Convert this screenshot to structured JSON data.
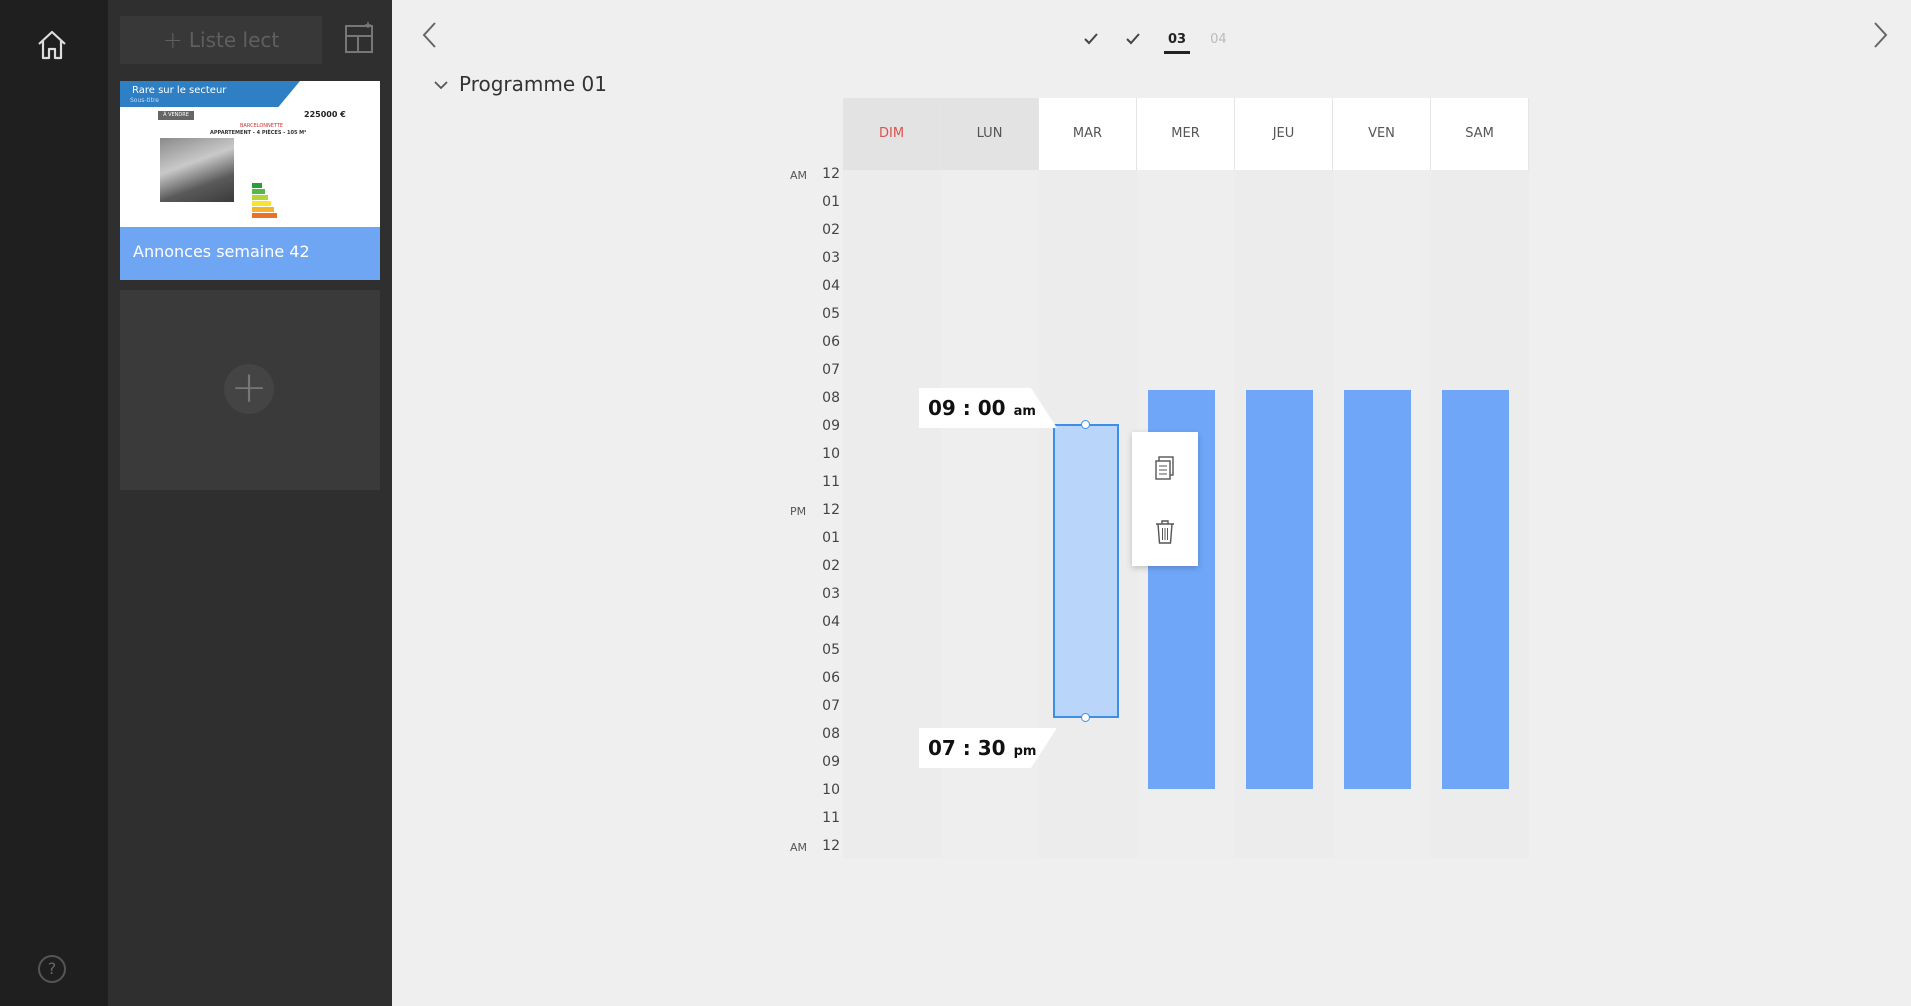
{
  "sidebar": {
    "add_list_label": "Liste lect",
    "add_list_plus": "+",
    "card": {
      "label": "Annonces semaine 42",
      "thumb": {
        "banner_title": "Rare sur le secteur",
        "banner_sub": "Sous-titre",
        "tag": "À VENDRE",
        "price": "225000 €",
        "subtitle": "BARCELONNETTE",
        "subtitle2": "APPARTEMENT - 4 PIÈCES - 105 M²"
      }
    },
    "new_card_plus": "+"
  },
  "rail": {
    "help_label": "?"
  },
  "stepper": {
    "current": "03",
    "next": "04"
  },
  "program": {
    "title": "Programme 01"
  },
  "days": [
    {
      "label": "DIM",
      "state": "disabled"
    },
    {
      "label": "LUN",
      "state": "disabled"
    },
    {
      "label": "MAR",
      "state": "active"
    },
    {
      "label": "MER",
      "state": "active"
    },
    {
      "label": "JEU",
      "state": "active"
    },
    {
      "label": "VEN",
      "state": "active"
    },
    {
      "label": "SAM",
      "state": "active"
    }
  ],
  "hours": [
    {
      "h": "12",
      "p": "AM"
    },
    {
      "h": "01"
    },
    {
      "h": "02"
    },
    {
      "h": "03"
    },
    {
      "h": "04"
    },
    {
      "h": "05"
    },
    {
      "h": "06"
    },
    {
      "h": "07"
    },
    {
      "h": "08"
    },
    {
      "h": "09"
    },
    {
      "h": "10"
    },
    {
      "h": "11"
    },
    {
      "h": "12",
      "p": "PM"
    },
    {
      "h": "01"
    },
    {
      "h": "02"
    },
    {
      "h": "03"
    },
    {
      "h": "04"
    },
    {
      "h": "05"
    },
    {
      "h": "06"
    },
    {
      "h": "07"
    },
    {
      "h": "08"
    },
    {
      "h": "09"
    },
    {
      "h": "10"
    },
    {
      "h": "11"
    },
    {
      "h": "12",
      "p": "AM"
    }
  ],
  "schedule": [
    {
      "day": "MER",
      "start": 8,
      "end": 22.25
    },
    {
      "day": "JEU",
      "start": 8,
      "end": 22.25
    },
    {
      "day": "VEN",
      "start": 8,
      "end": 22.25
    },
    {
      "day": "SAM",
      "start": 8,
      "end": 22.25
    }
  ],
  "selection": {
    "day": "MAR",
    "start": {
      "hhmm": "09 : 00",
      "suffix": "am",
      "value": 9
    },
    "end": {
      "hhmm": "07 : 30",
      "suffix": "pm",
      "value": 19.5
    }
  },
  "colors": {
    "accent": "#6fa6f8",
    "selection_fill": "#b9d5fa",
    "selection_border": "#3b8fe6",
    "disabled_header": "#e3e3e3",
    "disabled_label": "#d9534f"
  },
  "icons": [
    "home-icon",
    "help-icon",
    "layout-icon",
    "chevron-left-icon",
    "chevron-right-icon",
    "check-icon",
    "chevron-down-icon",
    "copy-icon",
    "trash-icon",
    "plus-icon"
  ]
}
